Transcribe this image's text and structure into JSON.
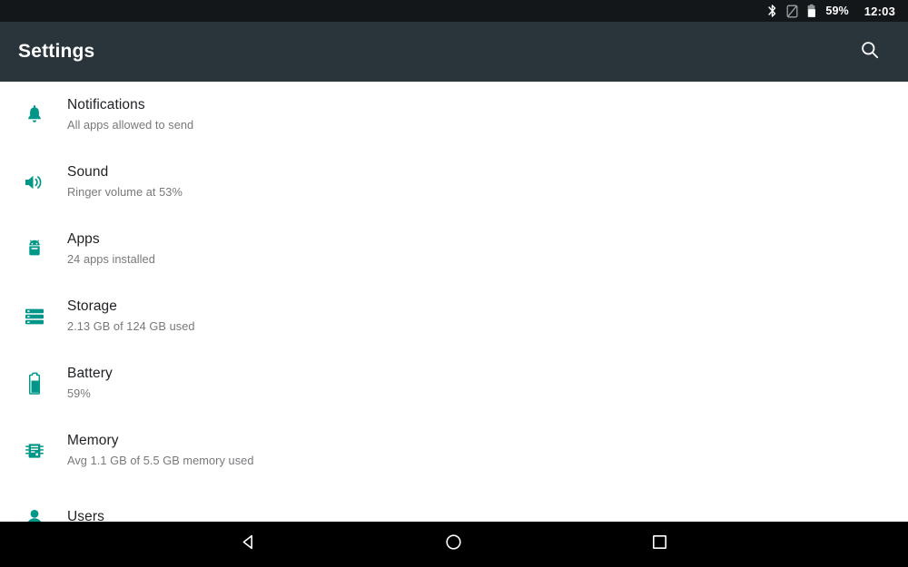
{
  "status_bar": {
    "icons": [
      {
        "name": "bluetooth-icon"
      },
      {
        "name": "sim-disabled-icon"
      },
      {
        "name": "battery-icon"
      }
    ],
    "battery_percent": "59%",
    "clock": "12:03"
  },
  "app_bar": {
    "title": "Settings",
    "search_label": "search-icon"
  },
  "settings": {
    "items": [
      {
        "icon": "notifications-bell-icon",
        "title": "Notifications",
        "subtitle": "All apps allowed to send"
      },
      {
        "icon": "sound-volume-icon",
        "title": "Sound",
        "subtitle": "Ringer volume at 53%"
      },
      {
        "icon": "apps-android-icon",
        "title": "Apps",
        "subtitle": "24 apps installed"
      },
      {
        "icon": "storage-icon",
        "title": "Storage",
        "subtitle": "2.13 GB of 124 GB used"
      },
      {
        "icon": "battery-icon",
        "title": "Battery",
        "subtitle": "59%"
      },
      {
        "icon": "memory-chip-icon",
        "title": "Memory",
        "subtitle": "Avg 1.1 GB of 5.5 GB memory used"
      },
      {
        "icon": "users-person-icon",
        "title": "Users",
        "subtitle": ""
      }
    ]
  },
  "nav_bar": {
    "back_label": "back-nav-button",
    "home_label": "home-nav-button",
    "recents_label": "recents-nav-button"
  },
  "colors": {
    "accent": "#009688",
    "app_bar": "#29343b",
    "status_bar": "#13171a",
    "title_text": "#1f2124",
    "subtitle_text": "#78797c"
  }
}
